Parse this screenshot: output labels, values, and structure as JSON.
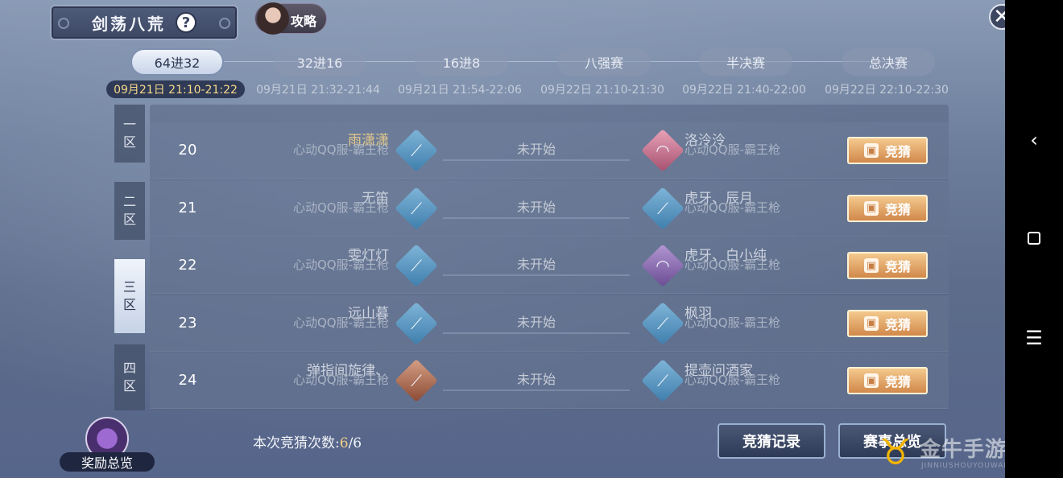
{
  "header": {
    "title": "剑荡八荒",
    "help_label": "?",
    "guide_label": "攻略",
    "close_label": "✕"
  },
  "stages": [
    {
      "label": "64进32",
      "time": "09月21日 21:10-21:22",
      "active": true
    },
    {
      "label": "32进16",
      "time": "09月21日 21:32-21:44",
      "active": false
    },
    {
      "label": "16进8",
      "time": "09月21日 21:54-22:06",
      "active": false
    },
    {
      "label": "八强赛",
      "time": "09月22日 21:10-21:30",
      "active": false
    },
    {
      "label": "半决赛",
      "time": "09月22日 21:40-22:00",
      "active": false
    },
    {
      "label": "总决赛",
      "time": "09月22日 22:10-22:30",
      "active": false
    }
  ],
  "zones": [
    {
      "top": "一",
      "bottom": "区"
    },
    {
      "top": "二",
      "bottom": "区"
    },
    {
      "top": "三",
      "bottom": "区"
    },
    {
      "top": "四",
      "bottom": "区"
    }
  ],
  "matches": [
    {
      "num": "20",
      "p1_name": "雨潇潇",
      "p1_server": "心动QQ服-霸王枪",
      "p1_emblem": "spear-blue",
      "status": "未开始",
      "p2_name": "洛泠泠",
      "p2_server": "心动QQ服-霸王枪",
      "p2_emblem": "fan-pink",
      "bet_label": "竞猜"
    },
    {
      "num": "21",
      "p1_name": "无笛",
      "p1_server": "心动QQ服-霸王枪",
      "p1_emblem": "spear-blue",
      "status": "未开始",
      "p2_name": "虎牙、辰月",
      "p2_server": "心动QQ服-霸王枪",
      "p2_emblem": "spear-blue",
      "bet_label": "竞猜"
    },
    {
      "num": "22",
      "p1_name": "雯灯灯",
      "p1_server": "心动QQ服-霸王枪",
      "p1_emblem": "spear-blue",
      "status": "未开始",
      "p2_name": "虎牙、白小纯",
      "p2_server": "心动QQ服-霸王枪",
      "p2_emblem": "fan-purple",
      "bet_label": "竞猜"
    },
    {
      "num": "23",
      "p1_name": "远山暮",
      "p1_server": "心动QQ服-霸王枪",
      "p1_emblem": "spear-blue",
      "status": "未开始",
      "p2_name": "枫羽",
      "p2_server": "心动QQ服-霸王枪",
      "p2_emblem": "spear-blue",
      "bet_label": "竞猜"
    },
    {
      "num": "24",
      "p1_name": "弹指间旋律、",
      "p1_server": "心动QQ服-霸王枪",
      "p1_emblem": "spear-copper",
      "status": "未开始",
      "p2_name": "提壶问酒家",
      "p2_server": "心动QQ服-霸王枪",
      "p2_emblem": "spear-blue",
      "bet_label": "竞猜"
    }
  ],
  "footer": {
    "count_label": "本次竞猜次数:",
    "count_used": "6",
    "count_total": "/6",
    "record_button": "竞猜记录",
    "overview_button": "赛事总览",
    "reward_label": "奖励总览"
  },
  "watermark": {
    "text": "金牛手游网",
    "sub": "JINNIUSHOUYOUWANG"
  },
  "colors": {
    "accent_gold": "#f2cf84",
    "bet_button": "#d1884b",
    "panel": "#58668a"
  }
}
